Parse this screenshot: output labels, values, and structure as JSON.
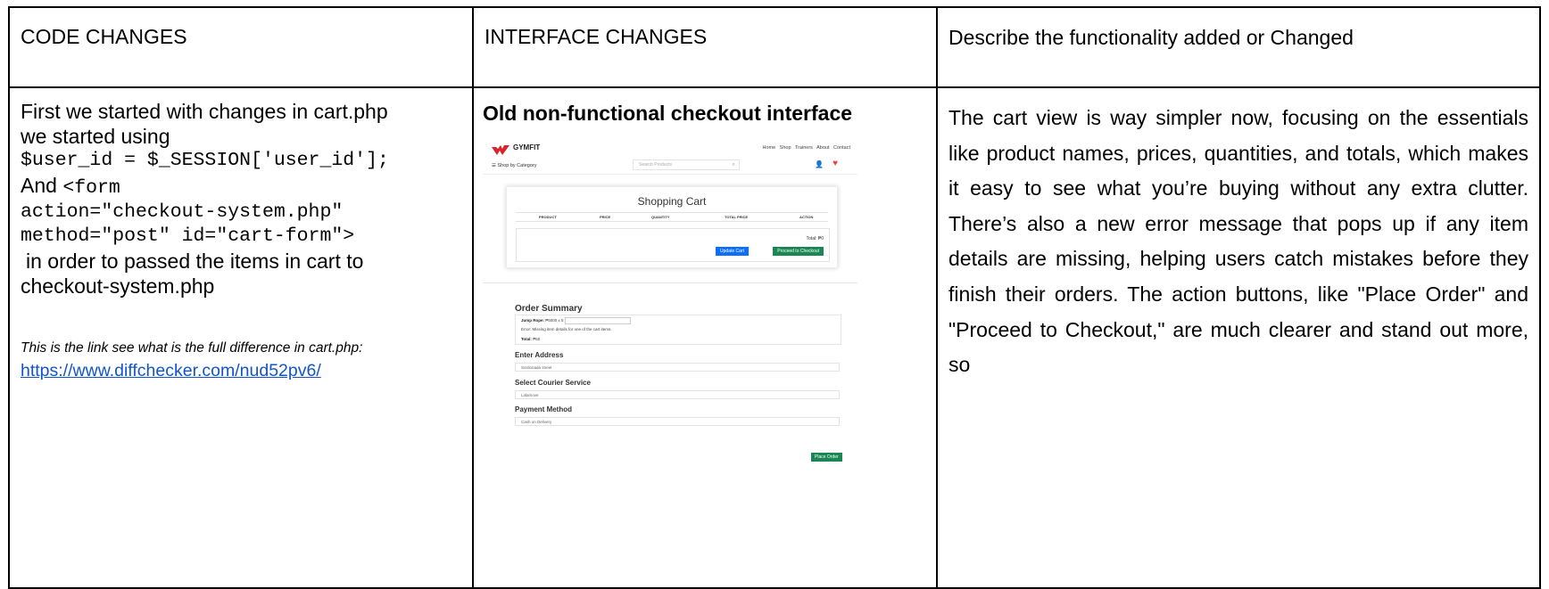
{
  "headers": {
    "code_changes": "CODE CHANGES",
    "interface_changes": "INTERFACE CHANGES",
    "functionality": "Describe the functionality added or Changed"
  },
  "code_cell": {
    "intro_line1": "First we started with changes in cart.php",
    "intro_line2": "we started using",
    "code1": "$user_id = $_SESSION['user_id'];",
    "and_label": "And",
    "code2a": "<form",
    "code2b": "action=\"checkout-system.php\"",
    "code2c": "method=\"post\" id=\"cart-form\">",
    "after1": "in order to passed the items in cart to",
    "after2": "checkout-system.php",
    "note": "This is the link see what is the full  difference in cart.php:",
    "link": "https://www.diffchecker.com/nud52pv6/"
  },
  "interface_cell": {
    "title": "Old non-functional checkout  interface",
    "mock": {
      "brand": "GYMFIT",
      "nav": "Home Shop Trainers About Contact",
      "shop_by_category": "Shop by Category",
      "search_placeholder": "Search Products",
      "cart_title": "Shopping Cart",
      "columns": [
        "PRODUCT",
        "PRICE",
        "QUANTITY",
        "TOTAL PRICE",
        "ACTION"
      ],
      "total": "Total: ₱0",
      "update_cart": "Update Cart",
      "proceed_checkout": "Proceed to Checkout",
      "order_summary": "Order Summary",
      "item_label": "Jump Rope:",
      "item_value": "₱5000 x 5",
      "error": "Error: Missing item details for one of the cart items.",
      "summary_total_label": "Total:",
      "summary_total_value": "₱50",
      "enter_address": "Enter Address",
      "address_value": "Sordonada street",
      "select_courier": "Select Courier Service",
      "courier_value": "Lalamove",
      "payment_method": "Payment Method",
      "payment_value": "Cash on Delivery",
      "place_order": "Place Order"
    }
  },
  "functionality_cell": {
    "text": "The cart view is way simpler now, focusing on the essentials like product names, prices, quantities, and totals, which makes it easy to see what you’re buying without any extra clutter. There’s also a new error message that pops up if any item details are missing, helping users catch mistakes before they finish their orders. The action buttons, like \"Place Order\" and \"Proceed to Checkout,\" are much clearer and stand out more, so"
  }
}
